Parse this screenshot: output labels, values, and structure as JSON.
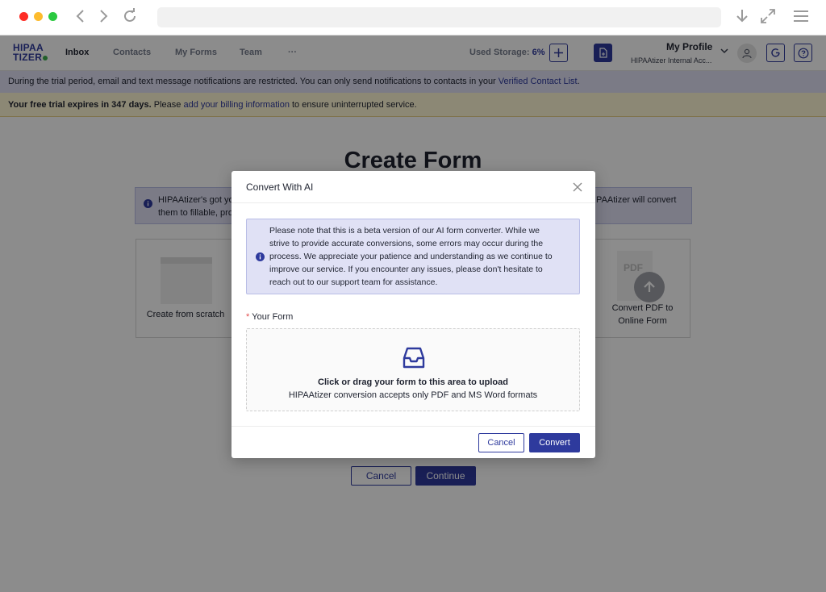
{
  "browser": {
    "icons": [
      "back-icon",
      "forward-icon",
      "reload-icon",
      "download-icon",
      "fullscreen-icon",
      "menu-icon"
    ],
    "url": ""
  },
  "nav": {
    "logo_line1": "HIPAA",
    "logo_line2": "TIZER",
    "items": [
      "Inbox",
      "Contacts",
      "My Forms",
      "Team",
      "···"
    ],
    "active": "Inbox",
    "storage_label": "Used Storage:",
    "storage_value": "6%",
    "profile_name": "My Profile",
    "profile_sub": "HIPAAtizer Internal Acc..."
  },
  "banners": {
    "trial_notice": "During the trial period, email and text message notifications are restricted. You can only send notifications to contacts in your ",
    "trial_notice_link": "Verified Contact List",
    "trial_notice_end": ".",
    "expiry_bold": "Your free trial expires in 347 days.",
    "expiry_text": " Please ",
    "expiry_link": "add your billing information",
    "expiry_end": " to ensure uninterrupted service."
  },
  "page": {
    "title": "Create Form",
    "info_text_1": "HIPAAtizer's got yo",
    "info_text_2": "them to fillable, pro",
    "info_text_3": "IPAAtizer will convert",
    "card_scratch": "Create from scratch",
    "card_pdf_tag": "PDF",
    "card_pdf_line1": "Convert PDF to",
    "card_pdf_line2": "Online Form",
    "cancel": "Cancel",
    "continue": "Continue"
  },
  "modal": {
    "title": "Convert With AI",
    "notice_lines": [
      "Please note that this is a beta version of our AI form converter. While we",
      "strive to provide accurate conversions, some errors may occur during the",
      "process. We appreciate your patience and understanding as we continue to",
      "improve our service. If you encounter any issues, please don't hesitate to",
      "reach out to our support team for assistance."
    ],
    "required_mark": "*",
    "field_label": "Your Form",
    "drop_title": "Click or drag your form to this area to upload",
    "drop_hint": "HIPAAtizer conversion accepts only PDF and MS Word formats",
    "cancel": "Cancel",
    "convert": "Convert"
  },
  "colors": {
    "brand": "#2e3a9d",
    "info_bg": "#e0e1f5",
    "warn_bg": "#fff7d6"
  }
}
